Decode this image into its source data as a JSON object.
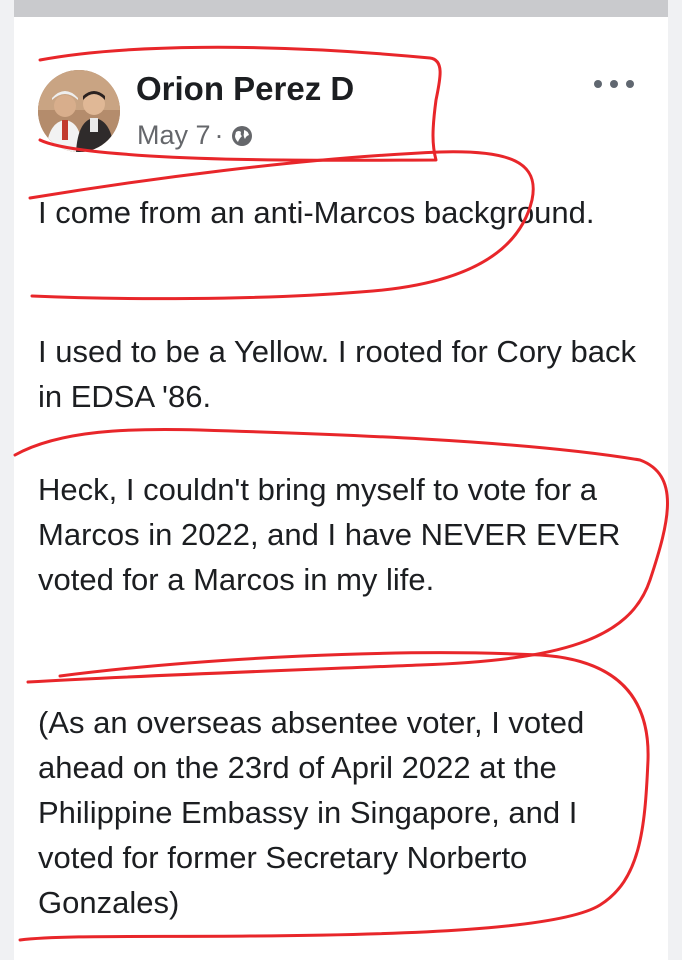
{
  "post": {
    "author": "Orion Perez D",
    "date": "May 7",
    "separator": "·",
    "privacy_icon": "globe-icon",
    "more_icon": "more-options-icon",
    "paragraphs": [
      "I come from an anti-Marcos background.",
      "I used to be a Yellow. I rooted for Cory back in EDSA '86.",
      "Heck, I couldn't bring myself to vote for a Marcos in 2022, and I have NEVER EVER voted for a Marcos in my life.",
      "(As an overseas absentee voter, I voted ahead on the 23rd of April 2022 at the Philippine Embassy in Singapore, and I voted for former Secretary Norberto Gonzales)"
    ]
  },
  "colors": {
    "annotation": "#e8262a",
    "author_text": "#1c1e21",
    "meta_text": "#65676b"
  }
}
